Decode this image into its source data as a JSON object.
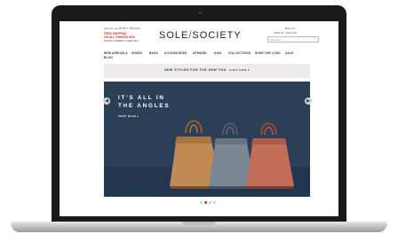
{
  "site": {
    "top_left_line1": "We love you ❤ (877) 781-6401",
    "promo_line1": "FREE SHIPPING",
    "promo_line2": "ON ALL ORDERS $50+",
    "promo_line3": "WHITE ORDERS OVER $50",
    "logo_left": "SOLE",
    "logo_slash": "/",
    "logo_right": "SOCIETY",
    "bag_label": "BAG (0)",
    "account_links": "SIGN IN  /  SIGN UP",
    "search_placeholder": "SEARCH",
    "search_icon_glyph": "⌕"
  },
  "nav": {
    "items": [
      "NEW ARRIVALS",
      "SHOES",
      "BAGS",
      "ACCESSORIES",
      "APPAREL",
      "KIDS",
      "COLLECTIONS",
      "SHOP THE LOOK",
      "SALE"
    ],
    "extra": "BLOG"
  },
  "strip": {
    "text": "NEW STYLES FOR THE NEW YOU",
    "cta": "SHOP NOW ▸"
  },
  "hero": {
    "headline_line1": "IT'S ALL IN",
    "headline_line2": "THE ANGLES",
    "cta": "SHOP BAGS ▸",
    "prev_glyph": "◀",
    "next_glyph": "▶",
    "bag_colors": [
      "#c08a55",
      "#7c8794",
      "#c26d5a"
    ]
  },
  "carousel": {
    "total": 4,
    "active_index": 1
  }
}
